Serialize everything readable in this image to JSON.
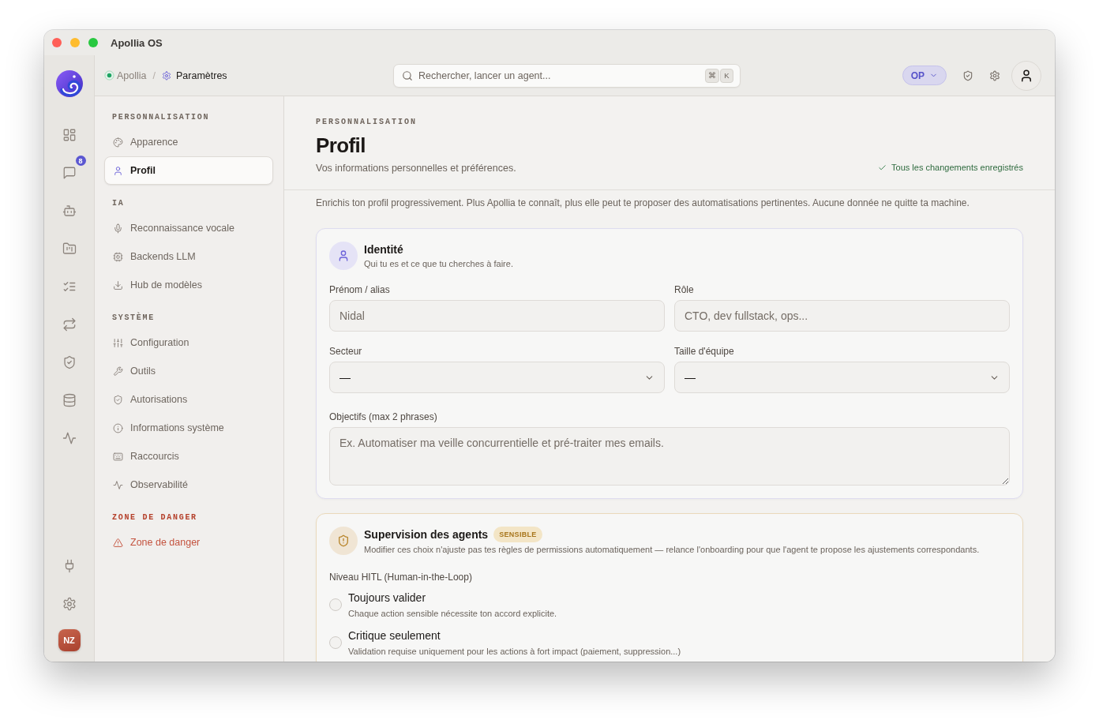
{
  "window": {
    "title": "Apollia OS"
  },
  "rail": {
    "items": [
      {
        "kind": "dashboard"
      },
      {
        "kind": "chat",
        "badge": "8"
      },
      {
        "kind": "robot"
      },
      {
        "kind": "folder"
      },
      {
        "kind": "checklist"
      },
      {
        "kind": "repeat"
      },
      {
        "kind": "shield"
      },
      {
        "kind": "database"
      },
      {
        "kind": "activity"
      }
    ],
    "bottom_items": [
      {
        "kind": "plug"
      },
      {
        "kind": "settings"
      }
    ],
    "avatar": "NZ"
  },
  "topbar": {
    "breadcrumb": [
      {
        "kind": "status",
        "label": "Apollia"
      },
      {
        "kind": "settings",
        "label": "Paramètres"
      }
    ],
    "separator": "/",
    "search": {
      "placeholder": "Rechercher, lancer un agent...",
      "shortcut": [
        "⌘",
        "K"
      ]
    },
    "mode_button": {
      "label": "OP"
    }
  },
  "settings_nav": {
    "sections": [
      {
        "kind": "default",
        "heading": "PERSONNALISATION",
        "items": [
          {
            "kind": "palette",
            "label": "Apparence",
            "selected": false
          },
          {
            "kind": "user",
            "label": "Profil",
            "selected": true
          }
        ]
      },
      {
        "kind": "default",
        "heading": "IA",
        "items": [
          {
            "kind": "mic",
            "label": "Reconnaissance vocale",
            "selected": false
          },
          {
            "kind": "cpu",
            "label": "Backends LLM",
            "selected": false
          },
          {
            "kind": "download",
            "label": "Hub de modèles",
            "selected": false
          }
        ]
      },
      {
        "kind": "default",
        "heading": "SYSTÈME",
        "items": [
          {
            "kind": "sliders",
            "label": "Configuration",
            "selected": false
          },
          {
            "kind": "wrench",
            "label": "Outils",
            "selected": false
          },
          {
            "kind": "shield",
            "label": "Autorisations",
            "selected": false
          },
          {
            "kind": "info",
            "label": "Informations système",
            "selected": false
          },
          {
            "kind": "keyboard",
            "label": "Raccourcis",
            "selected": false
          },
          {
            "kind": "activity",
            "label": "Observabilité",
            "selected": false
          }
        ]
      },
      {
        "kind": "danger",
        "heading": "ZONE DE DANGER",
        "items": [
          {
            "kind": "alert",
            "label": "Zone de danger",
            "selected": false
          }
        ]
      }
    ]
  },
  "page": {
    "eyebrow": "PERSONNALISATION",
    "title": "Profil",
    "subtitle": "Vos informations personnelles et préférences.",
    "save_status": "Tous les changements enregistrés",
    "intro": "Enrichis ton profil progressivement. Plus Apollia te connaît, plus elle peut te proposer des automatisations pertinentes. Aucune donnée ne quitte ta machine."
  },
  "cards": [
    {
      "kind": "identity",
      "title": "Identité",
      "subtitle": "Qui tu es et ce que tu cherches à faire.",
      "fields": [
        {
          "kind": "text",
          "label": "Prénom / alias",
          "placeholder": "Nidal"
        },
        {
          "kind": "text",
          "label": "Rôle",
          "placeholder": "CTO, dev fullstack, ops..."
        },
        {
          "kind": "select",
          "label": "Secteur",
          "value": "—"
        },
        {
          "kind": "select",
          "label": "Taille d'équipe",
          "value": "—"
        },
        {
          "kind": "textarea",
          "label": "Objectifs (max 2 phrases)",
          "placeholder": "Ex. Automatiser ma veille concurrentielle et pré-traiter mes emails."
        }
      ]
    },
    {
      "kind": "supervision",
      "title": "Supervision des agents",
      "badge": "SENSIBLE",
      "subtitle": "Modifier ces choix n'ajuste pas tes règles de permissions automatiquement — relance l'onboarding pour que l'agent te propose les ajustements correspondants.",
      "group_label": "Niveau HITL (Human-in-the-Loop)",
      "options": [
        {
          "label": "Toujours valider",
          "description": "Chaque action sensible nécessite ton accord explicite.",
          "selected": false
        },
        {
          "label": "Critique seulement",
          "description": "Validation requise uniquement pour les actions à fort impact (paiement, suppression...)",
          "selected": false
        }
      ]
    }
  ]
}
